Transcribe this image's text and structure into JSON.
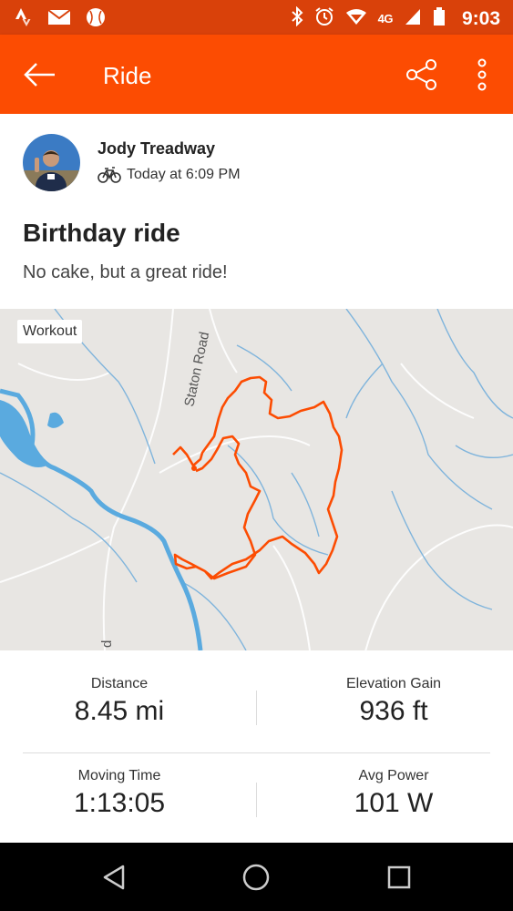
{
  "status_bar": {
    "time": "9:03",
    "network": "4G",
    "icons": [
      "strava-icon",
      "mail-icon",
      "baseball-icon",
      "bluetooth-icon",
      "alarm-icon",
      "wifi-icon",
      "signal-icon",
      "battery-icon"
    ]
  },
  "app_bar": {
    "title": "Ride",
    "back_icon": "back-arrow-icon",
    "actions": [
      "share-icon",
      "more-vert-icon"
    ]
  },
  "activity": {
    "athlete_name": "Jody Treadway",
    "time": "Today at 6:09 PM",
    "type_icon": "bike-icon",
    "title": "Birthday ride",
    "description": "No cake, but a great ride!"
  },
  "map": {
    "label": "Workout",
    "road_labels": [
      "Staton Road",
      "d"
    ],
    "route_color": "#fc4c02",
    "water_color": "#5aaadf"
  },
  "stats": [
    {
      "label": "Distance",
      "value": "8.45 mi"
    },
    {
      "label": "Elevation Gain",
      "value": "936 ft"
    },
    {
      "label": "Moving Time",
      "value": "1:13:05"
    },
    {
      "label": "Avg Power",
      "value": "101 W"
    }
  ],
  "nav_bar": {
    "buttons": [
      "back-triangle-icon",
      "home-circle-icon",
      "recents-square-icon"
    ]
  },
  "colors": {
    "status_bar": "#d9410a",
    "app_bar": "#fc4c02"
  }
}
